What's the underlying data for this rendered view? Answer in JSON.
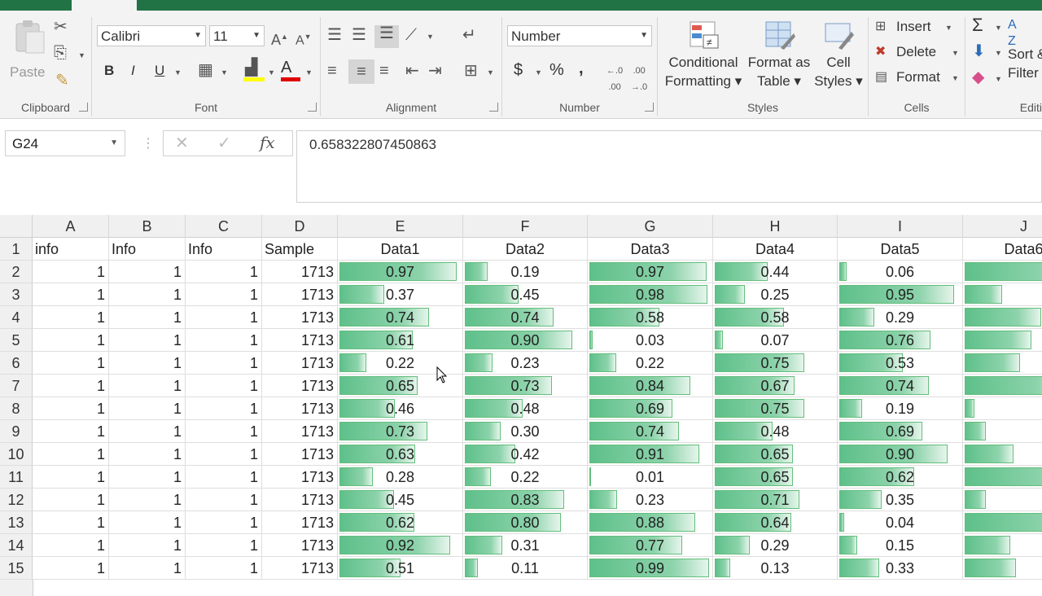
{
  "ribbon": {
    "clipboard": {
      "label": "Clipboard",
      "paste": "Paste"
    },
    "font": {
      "label": "Font",
      "name": "Calibri",
      "size": "11",
      "bold": "B",
      "italic": "I",
      "underline": "U"
    },
    "alignment": {
      "label": "Alignment"
    },
    "number": {
      "label": "Number",
      "format": "Number",
      "currency": "$",
      "percent": "%",
      "comma": ","
    },
    "styles": {
      "label": "Styles",
      "conditional": [
        "Conditional",
        "Formatting ▾"
      ],
      "format_table": [
        "Format as",
        "Table ▾"
      ],
      "cell_styles": [
        "Cell",
        "Styles ▾"
      ]
    },
    "cells": {
      "label": "Cells",
      "insert": "Insert",
      "delete": "Delete",
      "format": "Format"
    },
    "editing": {
      "label": "Editi",
      "sort": [
        "Sort &",
        "Filter"
      ]
    }
  },
  "formula_bar": {
    "name_box": "G24",
    "fx": "fx",
    "value": "0.658322807450863"
  },
  "sheet": {
    "columns": [
      "A",
      "B",
      "C",
      "D",
      "E",
      "F",
      "G",
      "H",
      "I",
      "J"
    ],
    "header_row": [
      "info",
      "Info",
      "Info",
      "Sample",
      "Data1",
      "Data2",
      "Data3",
      "Data4",
      "Data5",
      "Data6"
    ],
    "row_numbers": [
      "1",
      "2",
      "3",
      "4",
      "5",
      "6",
      "7",
      "8",
      "9",
      "10",
      "11",
      "12",
      "13",
      "14",
      "15"
    ],
    "info_values": [
      "1",
      "1",
      "1"
    ],
    "sample_value": "1713",
    "data": [
      [
        "0.97",
        "0.19",
        "0.97",
        "0.44",
        "0.06",
        "0.93"
      ],
      [
        "0.37",
        "0.45",
        "0.98",
        "0.25",
        "0.95",
        "0.32"
      ],
      [
        "0.74",
        "0.74",
        "0.58",
        "0.58",
        "0.29",
        "0.65"
      ],
      [
        "0.61",
        "0.90",
        "0.03",
        "0.07",
        "0.76",
        "0.57"
      ],
      [
        "0.22",
        "0.23",
        "0.22",
        "0.75",
        "0.53",
        "0.47"
      ],
      [
        "0.65",
        "0.73",
        "0.84",
        "0.67",
        "0.74",
        "0.89"
      ],
      [
        "0.46",
        "0.48",
        "0.69",
        "0.75",
        "0.19",
        "0.08"
      ],
      [
        "0.73",
        "0.30",
        "0.74",
        "0.48",
        "0.69",
        "0.18"
      ],
      [
        "0.63",
        "0.42",
        "0.91",
        "0.65",
        "0.90",
        "0.42"
      ],
      [
        "0.28",
        "0.22",
        "0.01",
        "0.65",
        "0.62",
        "0.95"
      ],
      [
        "0.45",
        "0.83",
        "0.23",
        "0.71",
        "0.35",
        "0.18"
      ],
      [
        "0.62",
        "0.80",
        "0.88",
        "0.64",
        "0.04",
        "0.99"
      ],
      [
        "0.92",
        "0.31",
        "0.77",
        "0.29",
        "0.15",
        "0.39"
      ],
      [
        "0.51",
        "0.11",
        "0.99",
        "0.13",
        "0.33",
        "0.44"
      ]
    ]
  },
  "colors": {
    "accent": "#217346",
    "databar": "#63be7b"
  }
}
